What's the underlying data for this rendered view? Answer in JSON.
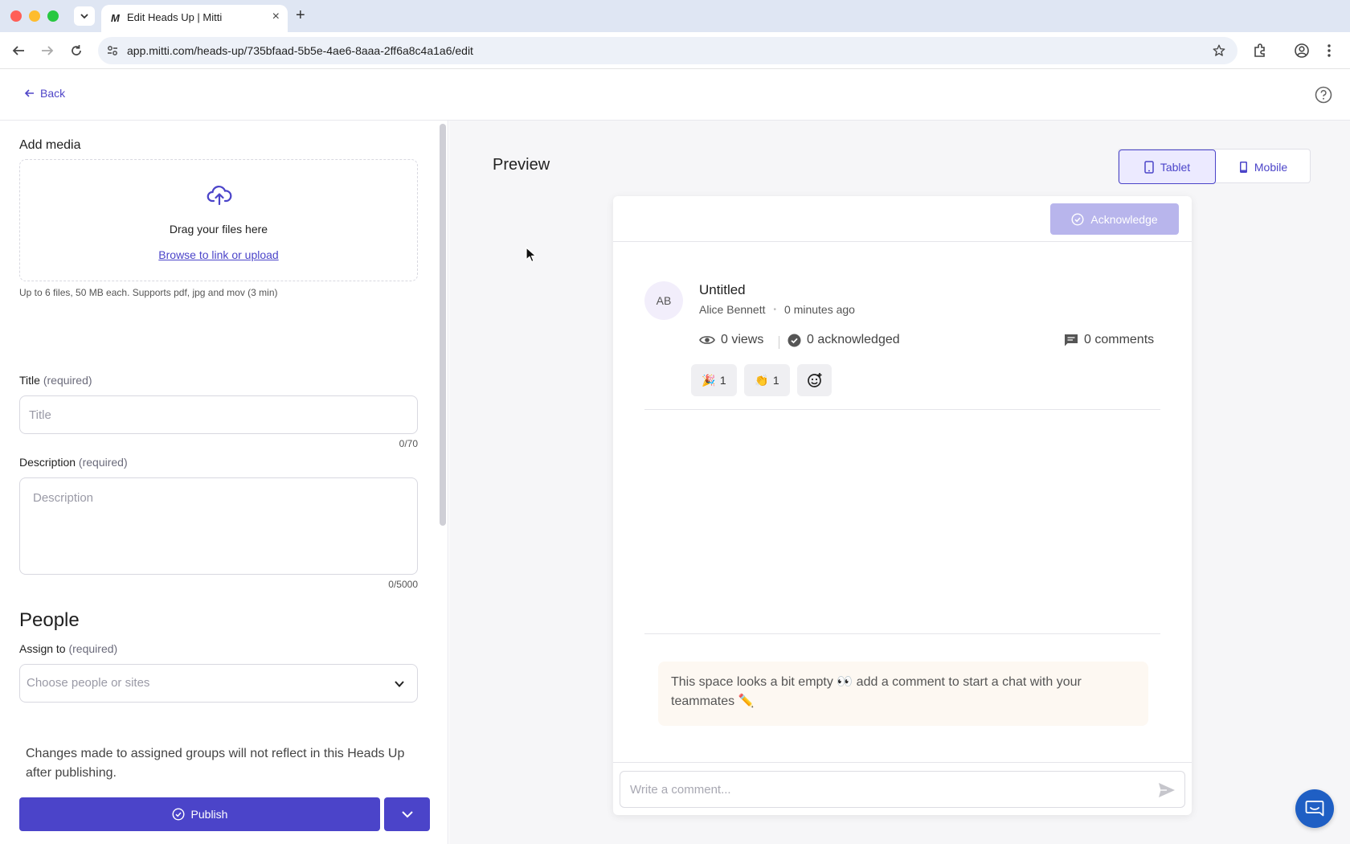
{
  "browser": {
    "tab_title": "Edit Heads Up | Mitti",
    "tab_favicon": "M",
    "url": "app.mitti.com/heads-up/735bfaad-5b5e-4ae6-8aaa-2ff6a8c4a1a6/edit",
    "traffic_colors": [
      "#ff5f57",
      "#febc2e",
      "#28c840"
    ]
  },
  "header": {
    "back_label": "Back",
    "help_icon": "help-circle-icon"
  },
  "form": {
    "media_label": "Add media",
    "drop_text": "Drag your files here",
    "browse_link": "Browse to link or upload",
    "media_hint": "Up to 6 files, 50 MB each. Supports pdf, jpg and mov (3 min)",
    "title_label": "Title",
    "title_required": "(required)",
    "title_placeholder": "Title",
    "title_counter": "0/70",
    "description_label": "Description",
    "description_required": "(required)",
    "description_placeholder": "Description",
    "description_counter": "0/5000",
    "people_heading": "People",
    "assign_label": "Assign to",
    "assign_required": "(required)",
    "assign_placeholder": "Choose people or sites"
  },
  "footer": {
    "notice": "Changes made to assigned groups will not reflect in this Heads Up after publishing.",
    "publish_label": "Publish"
  },
  "preview": {
    "heading": "Preview",
    "tablet_label": "Tablet",
    "mobile_label": "Mobile",
    "acknowledge_label": "Acknowledge",
    "avatar_initials": "AB",
    "post_title": "Untitled",
    "author": "Alice Bennett",
    "separator": "•",
    "time": "0 minutes ago",
    "views": "0 views",
    "acknowledged": "0 acknowledged",
    "comments": "0 comments",
    "reactions": [
      {
        "emoji": "🎉",
        "count": "1"
      },
      {
        "emoji": "👏",
        "count": "1"
      }
    ],
    "empty_message": "This space looks a bit empty 👀 add a comment to start a chat with your teammates ✏️",
    "comment_placeholder": "Write a comment..."
  },
  "colors": {
    "accent": "#4b44c9",
    "accent_soft": "#eceaff",
    "acknowledge_disabled": "#b8b5ec",
    "chat_fab": "#1f5fc4"
  }
}
